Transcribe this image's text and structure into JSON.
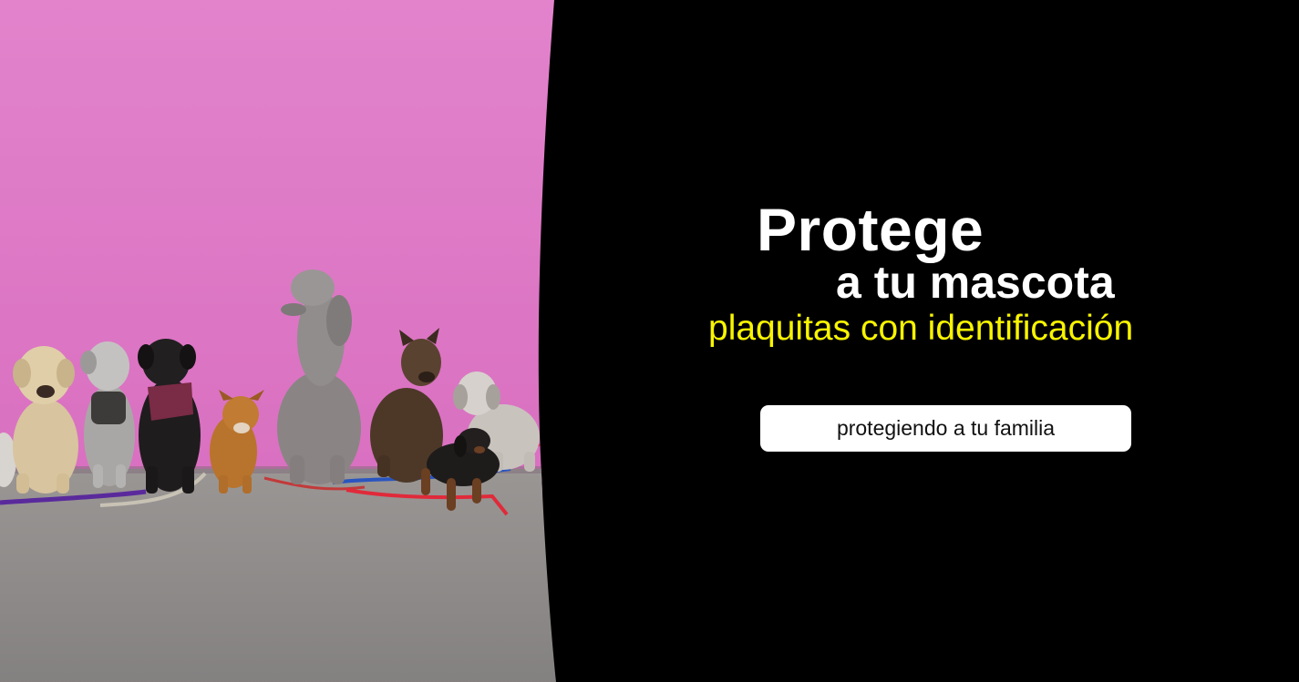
{
  "hero": {
    "headline": "Protege",
    "subline": "a tu mascota",
    "tagline": "plaquitas con identificación",
    "cta_label": "protegiendo a tu familia",
    "image_subject": "seven dogs on leashes sitting in a row in front of a pink wall on a grey sidewalk"
  },
  "colors": {
    "background": "#000000",
    "headline": "#ffffff",
    "tagline": "#f8f400",
    "wall": "#e078c8",
    "sidewalk": "#8f8b89",
    "cta_background": "#ffffff"
  }
}
